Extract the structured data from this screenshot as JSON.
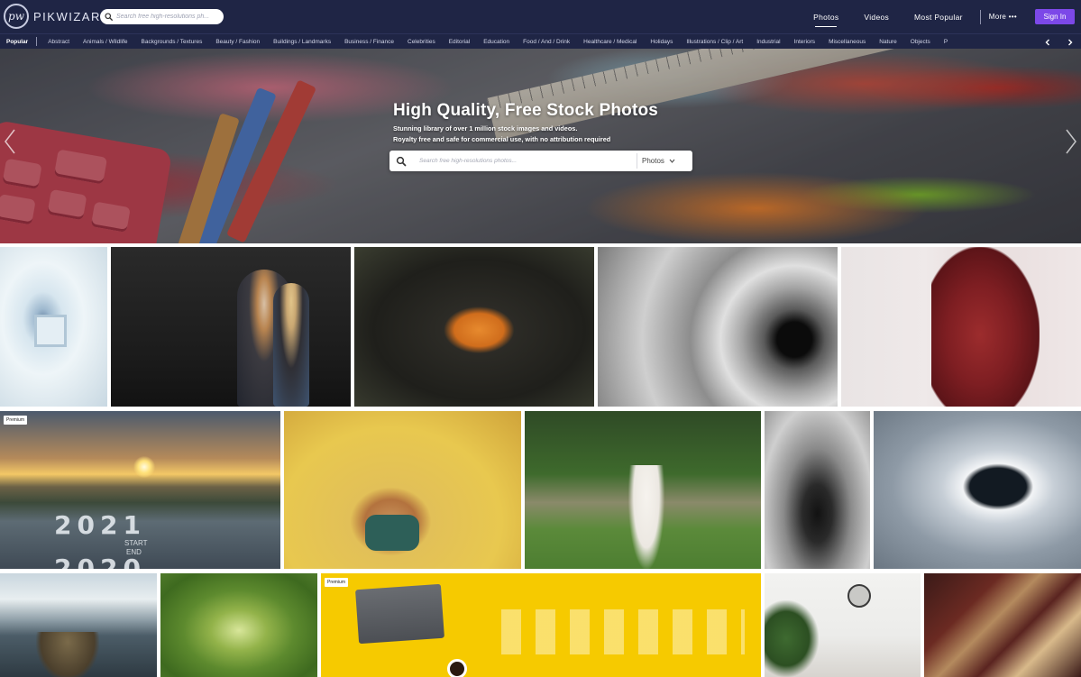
{
  "brand": {
    "logo_mark": "pw",
    "name": "PIKWIZARD"
  },
  "header": {
    "search_placeholder": "Search free high-resolutions ph...",
    "nav": [
      {
        "label": "Photos",
        "active": true
      },
      {
        "label": "Videos",
        "active": false
      },
      {
        "label": "Most Popular",
        "active": false
      }
    ],
    "more_label": "More •••",
    "signin_label": "Sign In"
  },
  "categories": {
    "popular_label": "Popular",
    "items": [
      "Abstract",
      "Animals / Wildlife",
      "Backgrounds / Textures",
      "Beauty / Fashion",
      "Buildings / Landmarks",
      "Business / Finance",
      "Celebrities",
      "Editorial",
      "Education",
      "Food / And / Drink",
      "Healthcare / Medical",
      "Holidays",
      "Illustrations / Clip / Art",
      "Industrial",
      "Interiors",
      "Miscellaneous",
      "Nature",
      "Objects",
      "P"
    ],
    "prev_icon": "chevron-left-icon",
    "next_icon": "chevron-right-icon"
  },
  "hero": {
    "title": "High Quality, Free Stock Photos",
    "subtitle_line1": "Stunning library of over 1 million stock images and videos.",
    "subtitle_line2": "Royalty free and safe for commercial use, with no attribution required",
    "search_placeholder": "Search free high-resolutions photos...",
    "search_type": "Photos",
    "prev_icon": "chevron-left-icon",
    "next_icon": "chevron-right-icon"
  },
  "gallery": {
    "badge_label": "Premium",
    "photos": [
      {
        "subject": "white corridor",
        "premium": false
      },
      {
        "subject": "couple walking with masks",
        "premium": false
      },
      {
        "subject": "hands holding pumpkin",
        "premium": false
      },
      {
        "subject": "black and white eye",
        "premium": false
      },
      {
        "subject": "pregnant woman in red dress",
        "premium": false
      },
      {
        "subject": "2021 road sunset",
        "premium": true,
        "text": [
          "2021",
          "START",
          "END",
          "2020"
        ]
      },
      {
        "subject": "woman with sunglasses yellow wall",
        "premium": false
      },
      {
        "subject": "wedding bride with guests",
        "premium": false
      },
      {
        "subject": "man sitting in forest",
        "premium": false
      },
      {
        "subject": "coffee cup in knit mittens",
        "premium": false
      },
      {
        "subject": "person on rock by sea",
        "premium": false
      },
      {
        "subject": "succulent plant",
        "premium": false
      },
      {
        "subject": "laptop on yellow desk with icons",
        "premium": true
      },
      {
        "subject": "shelf with plants and mirror",
        "premium": false
      },
      {
        "subject": "stack of old books",
        "premium": false
      }
    ]
  }
}
